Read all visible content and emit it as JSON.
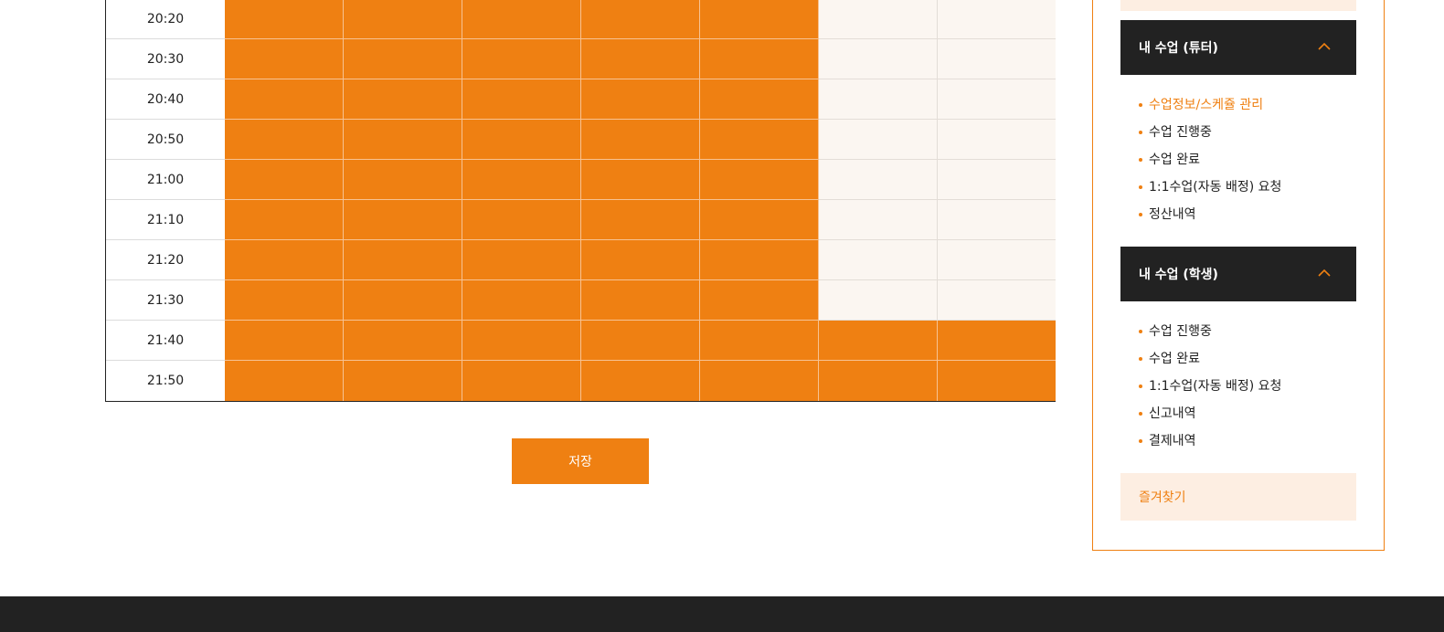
{
  "schedule": {
    "rows": [
      {
        "time": "20:20",
        "slots": [
          1,
          1,
          1,
          1,
          1,
          0,
          0
        ]
      },
      {
        "time": "20:30",
        "slots": [
          1,
          1,
          1,
          1,
          1,
          0,
          0
        ]
      },
      {
        "time": "20:40",
        "slots": [
          1,
          1,
          1,
          1,
          1,
          0,
          0
        ]
      },
      {
        "time": "20:50",
        "slots": [
          1,
          1,
          1,
          1,
          1,
          0,
          0
        ]
      },
      {
        "time": "21:00",
        "slots": [
          1,
          1,
          1,
          1,
          1,
          0,
          0
        ]
      },
      {
        "time": "21:10",
        "slots": [
          1,
          1,
          1,
          1,
          1,
          0,
          0
        ]
      },
      {
        "time": "21:20",
        "slots": [
          1,
          1,
          1,
          1,
          1,
          0,
          0
        ]
      },
      {
        "time": "21:30",
        "slots": [
          1,
          1,
          1,
          1,
          1,
          0,
          0
        ]
      },
      {
        "time": "21:40",
        "slots": [
          1,
          1,
          1,
          1,
          1,
          1,
          1
        ]
      },
      {
        "time": "21:50",
        "slots": [
          1,
          1,
          1,
          1,
          1,
          1,
          1
        ]
      }
    ],
    "colors": {
      "selected": "#ef8012",
      "unselected": "#fbf6f1"
    }
  },
  "save_label": "저장",
  "sidebar": {
    "tutor_menu": {
      "title": "내 수업 (튜터)",
      "expanded": true,
      "items": [
        {
          "label": "수업정보/스케쥴 관리",
          "active": true
        },
        {
          "label": "수업 진행중",
          "active": false
        },
        {
          "label": "수업 완료",
          "active": false
        },
        {
          "label": "1:1수업(자동 배정) 요청",
          "active": false
        },
        {
          "label": "정산내역",
          "active": false
        }
      ]
    },
    "student_menu": {
      "title": "내 수업 (학생)",
      "expanded": true,
      "items": [
        {
          "label": "수업 진행중",
          "active": false
        },
        {
          "label": "수업 완료",
          "active": false
        },
        {
          "label": "1:1수업(자동 배정) 요청",
          "active": false
        },
        {
          "label": "신고내역",
          "active": false
        },
        {
          "label": "결제내역",
          "active": false
        }
      ]
    },
    "favorites_label": "즐겨찾기",
    "icons": {
      "expand": "chevron-up-icon",
      "bullet": "bullet-dot-icon"
    },
    "accent_color": "#ef8012",
    "header_color": "#222222"
  }
}
